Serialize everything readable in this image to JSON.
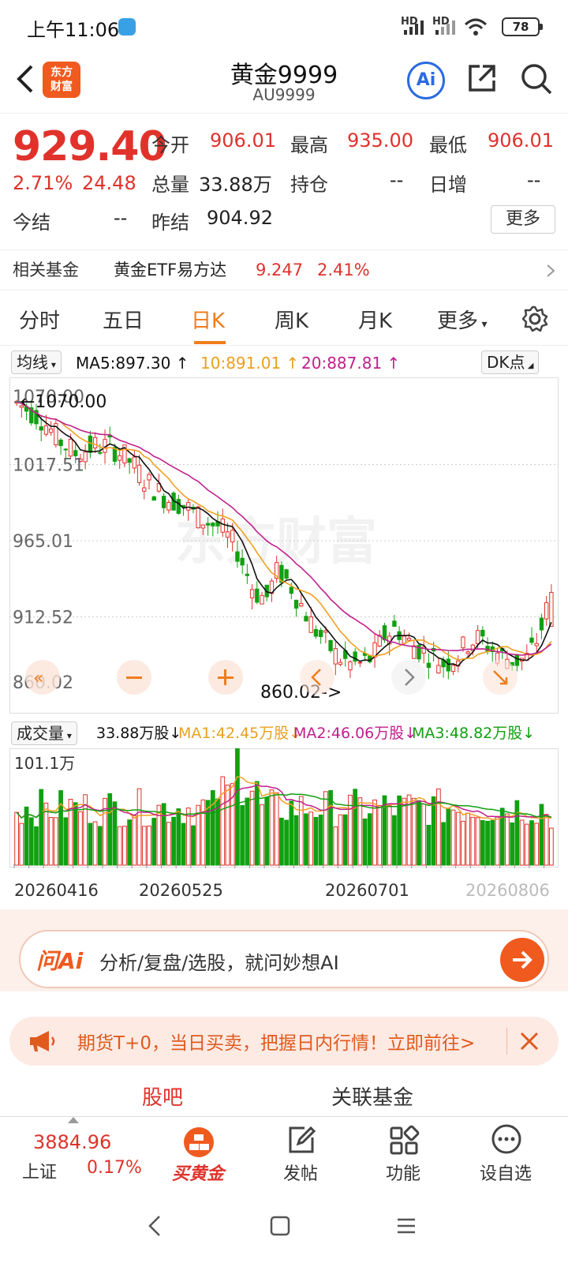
{
  "status": {
    "time": "上午11:06",
    "battery": "78",
    "sig1": "HD",
    "sig2": "HD"
  },
  "header": {
    "back": "<",
    "logo_line1": "东方",
    "logo_line2": "财富",
    "title": "黄金9999",
    "code": "AU9999",
    "ai": "Ai"
  },
  "quote": {
    "price": "929.40",
    "pct": "2.71%",
    "chg": "24.48",
    "open_label": "今开",
    "open": "906.01",
    "high_label": "最高",
    "high": "935.00",
    "low_label": "最低",
    "low": "906.01",
    "vol_label": "总量",
    "vol": "33.88万",
    "pos_label": "持仓",
    "pos": "--",
    "inc_label": "日增",
    "inc": "--",
    "settle_label": "今结",
    "settle": "--",
    "prev_label": "昨结",
    "prev": "904.92",
    "more": "更多"
  },
  "fund": {
    "label": "相关基金",
    "name": "黄金ETF易方达",
    "price": "9.247",
    "pct": "2.41%"
  },
  "tabs": [
    "分时",
    "五日",
    "日K",
    "周K",
    "月K",
    "更多"
  ],
  "ma": {
    "selector": "均线",
    "ma5": "MA5:897.30",
    "ma10": "10:891.01",
    "ma20": "20:887.81",
    "dk": "DK点"
  },
  "kchart": {
    "ylabels": [
      "1070.00",
      "1017.51",
      "965.01",
      "912.52",
      "860.02"
    ],
    "max_label": "1070.00",
    "min_label": "860.02",
    "watermark": "东方财富"
  },
  "volume": {
    "selector": "成交量",
    "total": "33.88万股",
    "ma1": "MA1:42.45万股",
    "ma2": "MA2:46.06万股",
    "ma3": "MA3:48.82万股",
    "ymax": "101.1万"
  },
  "dates": [
    "20260416",
    "20260525",
    "20260701",
    "20260806"
  ],
  "ai": {
    "brand": "问Ai",
    "placeholder": "分析/复盘/选股，就问妙想AI"
  },
  "promo": {
    "text": "期货T+0，当日买卖，把握日内行情！立即前往>"
  },
  "sub_tabs": [
    "股吧",
    "关联基金"
  ],
  "nav": {
    "index_value": "3884.96",
    "index_name": "上证",
    "index_pct": "0.17%",
    "buy": "买黄金",
    "post": "发帖",
    "func": "功能",
    "watch": "设自选"
  },
  "colors": {
    "up": "#e0322b",
    "down": "#11a011",
    "ma5": "#111111",
    "ma10": "#f0a020",
    "ma20": "#c0208c",
    "accent": "#f07d1b"
  }
}
